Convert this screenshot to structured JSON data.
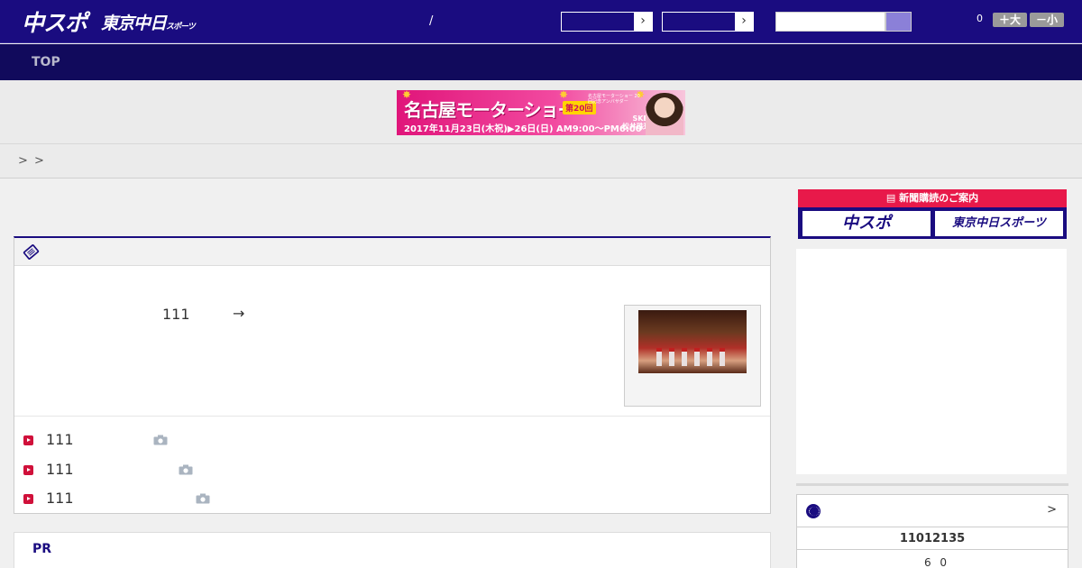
{
  "header": {
    "logo_primary": "中スポ",
    "logo_secondary": "東京中日",
    "logo_secondary_small": "スポーツ",
    "divider_text": "/",
    "select_arrow": "›",
    "font_count": "0",
    "font_larger": "＋大",
    "font_smaller": "－小",
    "colors": {
      "bg": "#1a0c80",
      "search_button": "#8b80d8"
    }
  },
  "nav": {
    "items": [
      {
        "label": "TOP"
      }
    ]
  },
  "banner": {
    "title": "名古屋モーターショー",
    "badge": "第20回",
    "dates": "2017年11月23日(木祝)▶26日(日) AM9:00〜PM6:00",
    "small_text": "名古屋モーターショー 20回記念アンバサダー",
    "ambassador_group": "SKE48",
    "ambassador_name": "松井珠理奈",
    "colors": {
      "bg": "#e0157a"
    }
  },
  "breadcrumb": {
    "separators": [
      ">",
      ">"
    ]
  },
  "main": {
    "panel_icon": "ticket-icon",
    "headline": {
      "number": "111",
      "arrow": "→"
    },
    "list": [
      {
        "number": "111",
        "icon": "camera-icon"
      },
      {
        "number": "111",
        "icon": "camera-icon"
      },
      {
        "number": "111",
        "icon": "camera-icon"
      }
    ],
    "pr_label": "PR"
  },
  "sidebar": {
    "subscription_title": "新聞購読のご案内",
    "subscription_buttons": [
      "中スポ",
      "東京中日スポーツ"
    ],
    "score": {
      "icon": "baseball-icon",
      "more": ">",
      "date": "11012135",
      "value": "6 0"
    },
    "colors": {
      "subscription_head": "#e8194a"
    }
  }
}
